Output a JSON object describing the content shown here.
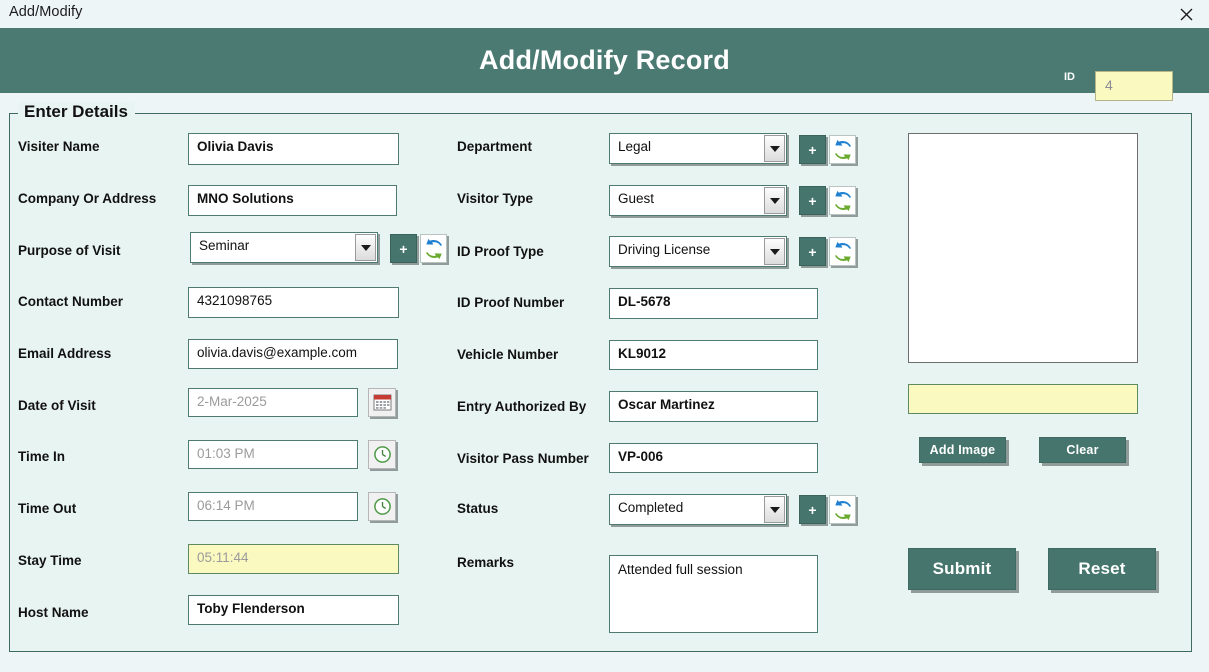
{
  "window": {
    "title": "Add/Modify",
    "close_icon": "close-icon"
  },
  "header": {
    "title": "Add/Modify Record",
    "id_label": "ID",
    "id_value": "4"
  },
  "group": {
    "legend": "Enter Details"
  },
  "colors": {
    "accent_teal": "#4b7a73",
    "panel_bg": "#e8f4f1",
    "window_bg": "#eef5f7",
    "highlight_yellow": "#faf9c0",
    "field_border": "#4e7a72"
  },
  "left_fields": [
    {
      "label": "Visiter Name",
      "value": "Olivia Davis",
      "style": "bold"
    },
    {
      "label": "Company Or Address",
      "value": "MNO Solutions",
      "style": "bold"
    },
    {
      "label": "Purpose of Visit",
      "value": "Seminar",
      "style": "combo"
    },
    {
      "label": "Contact Number",
      "value": "4321098765",
      "style": "plain"
    },
    {
      "label": "Email Address",
      "value": "olivia.davis@example.com",
      "style": "plain"
    },
    {
      "label": "Date of Visit",
      "value": "2-Mar-2025",
      "style": "muted"
    },
    {
      "label": "Time In",
      "value": "01:03 PM",
      "style": "muted"
    },
    {
      "label": "Time Out",
      "value": "06:14 PM",
      "style": "muted"
    },
    {
      "label": "Stay Time",
      "value": "05:11:44",
      "style": "yellow"
    },
    {
      "label": "Host Name",
      "value": "Toby Flenderson",
      "style": "bold"
    }
  ],
  "middle_fields": [
    {
      "label": "Department",
      "value": "Legal",
      "style": "combo"
    },
    {
      "label": "Visitor Type",
      "value": "Guest",
      "style": "combo"
    },
    {
      "label": "ID Proof Type",
      "value": "Driving License",
      "style": "combo"
    },
    {
      "label": "ID Proof Number",
      "value": "DL-5678",
      "style": "bold"
    },
    {
      "label": "Vehicle Number",
      "value": "KL9012",
      "style": "bold"
    },
    {
      "label": "Entry Authorized By",
      "value": "Oscar Martinez",
      "style": "bold"
    },
    {
      "label": "Visitor Pass Number",
      "value": "VP-006",
      "style": "bold"
    },
    {
      "label": "Status",
      "value": "Completed",
      "style": "combo"
    },
    {
      "label": "Remarks",
      "value": "Attended full session",
      "style": "textarea"
    }
  ],
  "icons": {
    "add": "+",
    "refresh": "refresh-icon",
    "calendar": "calendar-icon",
    "clock": "clock-icon"
  },
  "image_panel": {
    "path_value": "",
    "add_image_label": "Add Image",
    "clear_label": "Clear"
  },
  "actions": {
    "submit_label": "Submit",
    "reset_label": "Reset"
  }
}
